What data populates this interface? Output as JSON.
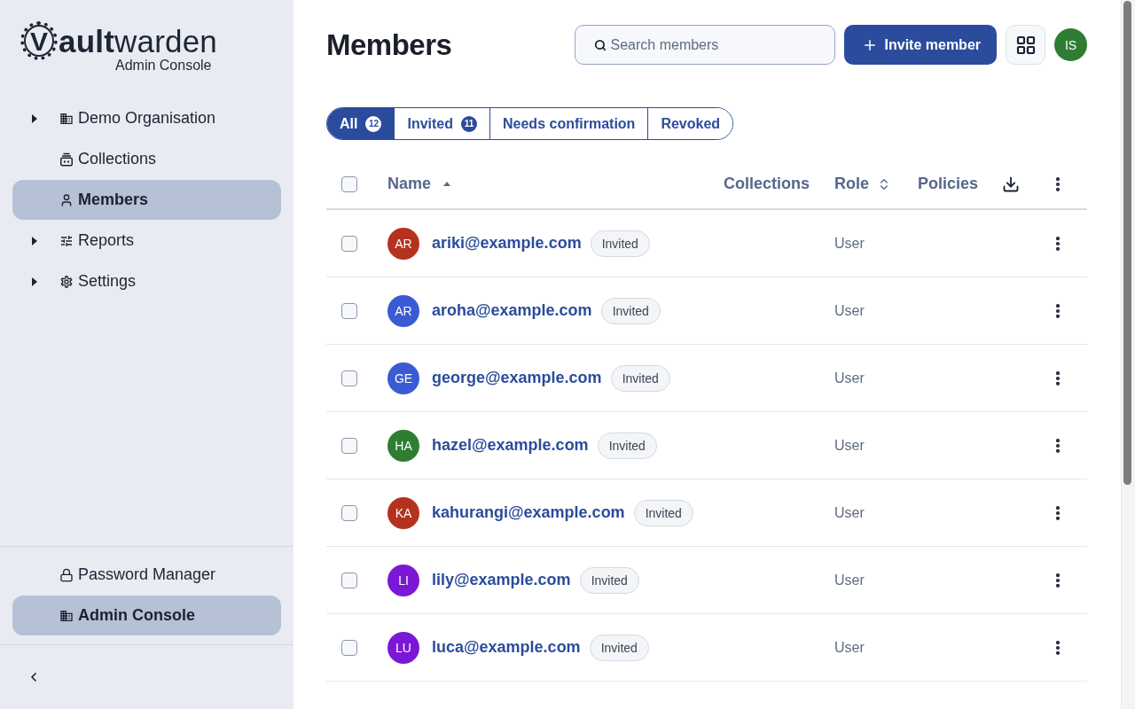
{
  "sidebar": {
    "logo": {
      "mark": "V",
      "wordmark": "**ault**warden",
      "subtitle": "Admin Console"
    },
    "nav": [
      {
        "kind": "group",
        "label": "Demo Organisation",
        "expanded": false,
        "selected": false
      },
      {
        "kind": "link",
        "label": "Collections",
        "selected": false
      },
      {
        "kind": "link",
        "label": "Members",
        "selected": true
      },
      {
        "kind": "group",
        "label": "Reports",
        "expanded": false,
        "selected": false
      },
      {
        "kind": "group",
        "label": "Settings",
        "expanded": false,
        "selected": false
      }
    ],
    "products": [
      {
        "label": "Password Manager",
        "selected": false
      },
      {
        "label": "Admin Console",
        "selected": true
      }
    ]
  },
  "header": {
    "title": "Members",
    "search": {
      "placeholder": "Search members"
    },
    "invite_button": "Invite member",
    "user": {
      "initials": "IS",
      "color": "#2e7d32"
    }
  },
  "filters": [
    {
      "label": "All",
      "count": "12",
      "selected": true
    },
    {
      "label": "Invited",
      "count": "11",
      "selected": false
    },
    {
      "label": "Needs confirmation",
      "selected": false
    },
    {
      "label": "Revoked",
      "selected": false
    }
  ],
  "table": {
    "select_all": {
      "checked": false
    },
    "columns": [
      {
        "label": "Name",
        "sorted": true
      },
      {
        "label": "Collections"
      },
      {
        "label": "Role",
        "sorted": false
      },
      {
        "label": "Policies"
      }
    ],
    "rows": [
      {
        "initials": "AR",
        "color": "#b5321f",
        "email": "ariki@example.com",
        "status": "Invited",
        "role": "User",
        "checked": false
      },
      {
        "initials": "AR",
        "color": "#3a5bd4",
        "email": "aroha@example.com",
        "status": "Invited",
        "role": "User",
        "checked": false
      },
      {
        "initials": "GE",
        "color": "#3a5bd4",
        "email": "george@example.com",
        "status": "Invited",
        "role": "User",
        "checked": false
      },
      {
        "initials": "HA",
        "color": "#2e7d32",
        "email": "hazel@example.com",
        "status": "Invited",
        "role": "User",
        "checked": false
      },
      {
        "initials": "KA",
        "color": "#b5321f",
        "email": "kahurangi@example.com",
        "status": "Invited",
        "role": "User",
        "checked": false
      },
      {
        "initials": "LI",
        "color": "#7b17d6",
        "email": "lily@example.com",
        "status": "Invited",
        "role": "User",
        "checked": false
      },
      {
        "initials": "LU",
        "color": "#7b17d6",
        "email": "luca@example.com",
        "status": "Invited",
        "role": "User",
        "checked": false
      }
    ]
  }
}
